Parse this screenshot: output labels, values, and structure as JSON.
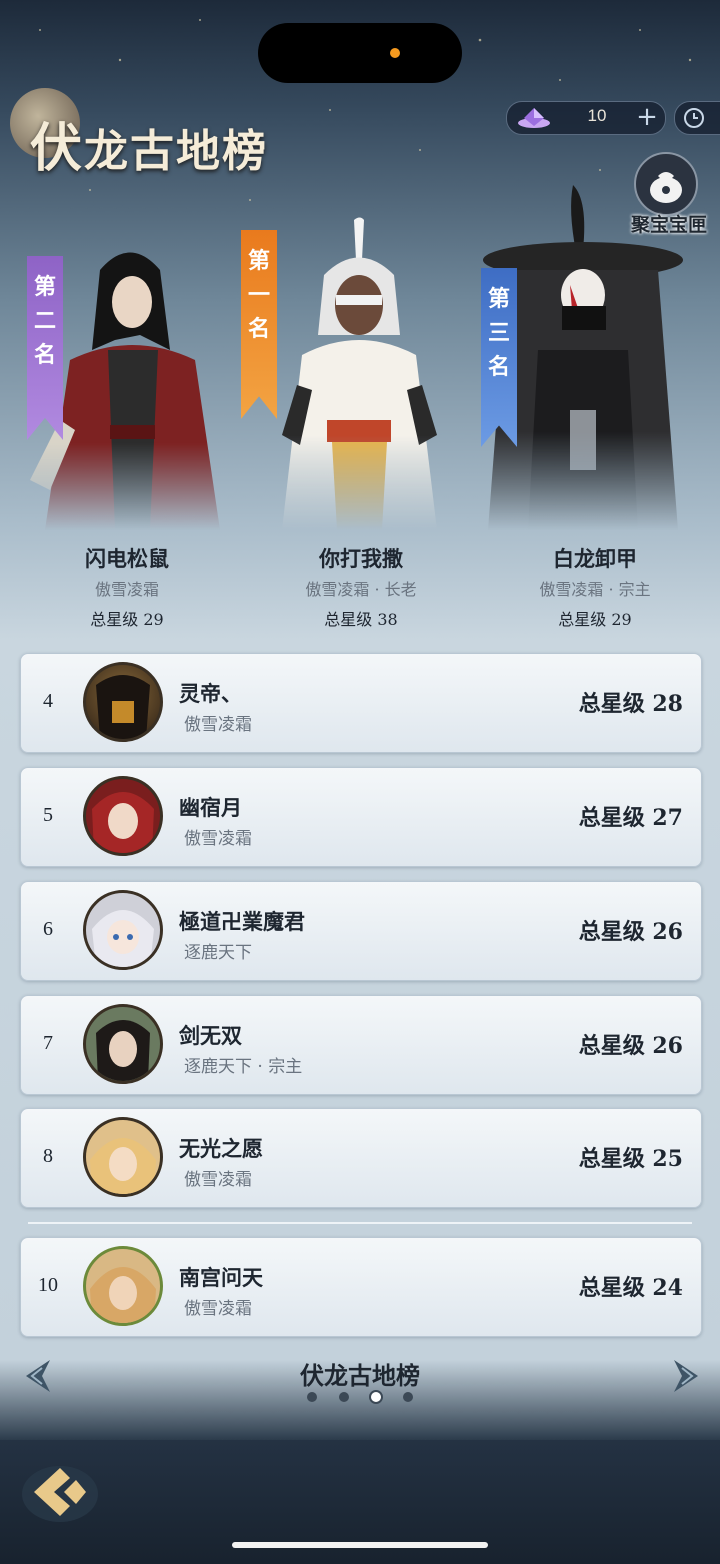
{
  "header": {
    "title_first": "伏",
    "title_rest": "龙古地榜"
  },
  "currency": {
    "value": "10"
  },
  "treasure": {
    "label": "聚宝宝匣"
  },
  "podium": [
    {
      "banner": "第二名",
      "name": "闪电松鼠",
      "guild": "傲雪凌霜",
      "stars": "总星级 29"
    },
    {
      "banner": "第一名",
      "name": "你打我撒",
      "guild": "傲雪凌霜 · 长老",
      "stars": "总星级 38"
    },
    {
      "banner": "第三名",
      "name": "白龙卸甲",
      "guild": "傲雪凌霜 · 宗主",
      "stars": "总星级 29"
    }
  ],
  "rows": [
    {
      "rank": "4",
      "name": "灵帝、",
      "guild": "傲雪凌霜",
      "stars": "总星级 28"
    },
    {
      "rank": "5",
      "name": "幽宿月",
      "guild": "傲雪凌霜",
      "stars": "总星级 27"
    },
    {
      "rank": "6",
      "name": "極道卍業魔君",
      "guild": "逐鹿天下",
      "stars": "总星级 26"
    },
    {
      "rank": "7",
      "name": "剑无双",
      "guild": "逐鹿天下 · 宗主",
      "stars": "总星级 26"
    },
    {
      "rank": "8",
      "name": "无光之愿",
      "guild": "傲雪凌霜",
      "stars": "总星级 25"
    },
    {
      "rank": "10",
      "name": "南宫问天",
      "guild": "傲雪凌霜",
      "stars": "总星级 24"
    }
  ],
  "pager": {
    "title": "伏龙古地榜",
    "pages": 4,
    "current_page": 3
  },
  "icons": [
    "gem-icon",
    "plus-icon",
    "clock-icon",
    "treasure-bag-icon",
    "prev-arrow-icon",
    "next-arrow-icon",
    "back-icon"
  ],
  "colors": {
    "rank1": "#f3a443",
    "rank2": "#b18ae0",
    "rank3": "#6c9be4",
    "panel": "#e6edf2"
  }
}
